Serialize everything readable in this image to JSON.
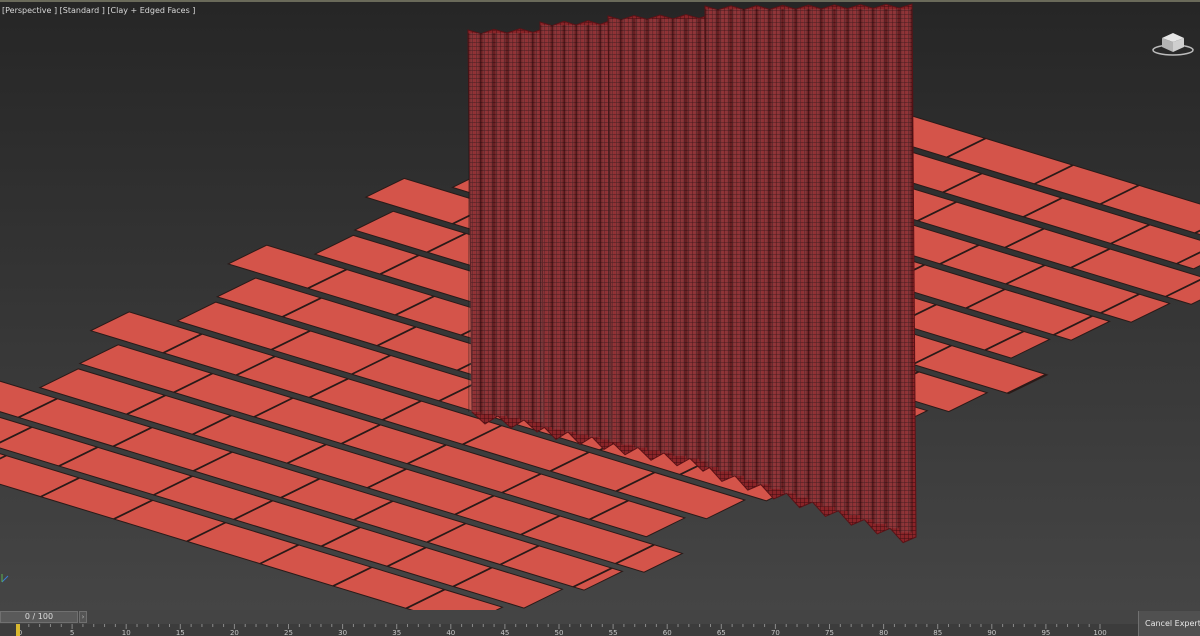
{
  "viewport": {
    "label": "[Perspective ] [Standard ] [Clay + Edged Faces ]"
  },
  "viewcube": {
    "icon": "viewcube-icon"
  },
  "timeline": {
    "slider_label": "0 / 100",
    "prev_icon": "chevron-left-icon",
    "next_icon": "chevron-right-icon",
    "ticks": [
      "0",
      "5",
      "10",
      "15",
      "20",
      "25",
      "30",
      "35",
      "40",
      "45",
      "50",
      "55",
      "60",
      "65",
      "70",
      "75",
      "80",
      "85",
      "90",
      "95",
      "100"
    ],
    "current_frame": 0,
    "total_frames": 100
  },
  "status": {
    "cancel_expert_label": "Cancel Expert Mode"
  },
  "colors": {
    "floor_fill": "#d4544a",
    "floor_edge": "#2a1a18",
    "curtain": "#8a2428",
    "curtain_dark": "#5a1216",
    "marker": "#d8b830"
  }
}
